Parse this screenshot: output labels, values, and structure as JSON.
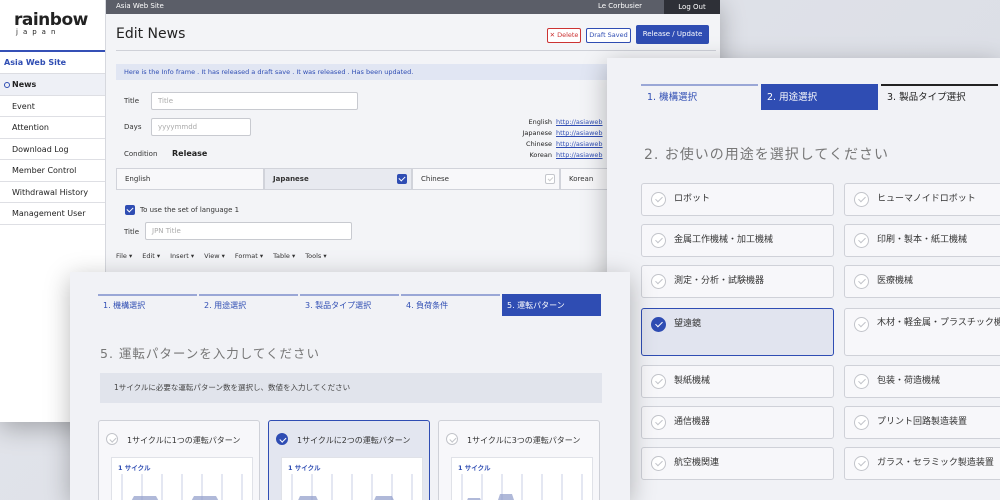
{
  "cms": {
    "logo": {
      "main": "rainbow",
      "sub": "japan"
    },
    "site_name": "Asia Web Site",
    "nav": [
      "News",
      "Event",
      "Attention",
      "Download Log",
      "Member Control",
      "Withdrawal History",
      "Management User"
    ],
    "topbar": {
      "site": "Asia Web Site",
      "user": "Le Corbusier",
      "logout": "Log Out"
    },
    "page_title": "Edit News",
    "buttons": {
      "delete": "✕ Delete",
      "draft": "Draft Saved",
      "release": "Release / Update"
    },
    "info": "Here is the Info frame . It has released a draft save . It was released . Has been updated.",
    "form": {
      "title_label": "Title",
      "title_placeholder": "Title",
      "days_label": "Days",
      "days_placeholder": "yyyymmdd",
      "condition_label": "Condition",
      "condition_value": "Release"
    },
    "languages": [
      {
        "name": "English",
        "url": "http://asiaweb"
      },
      {
        "name": "Japanese",
        "url": "http://asiaweb"
      },
      {
        "name": "Chinese",
        "url": "http://asiaweb"
      },
      {
        "name": "Korean",
        "url": "http://asiaweb"
      }
    ],
    "tabs": [
      "English",
      "Japanese",
      "Chinese",
      "Korean"
    ],
    "use_set_label": "To use the set of language 1",
    "jpn_title_label": "Title",
    "jpn_title_placeholder": "JPN Title",
    "editor_menu": [
      "File ▾",
      "Edit ▾",
      "Insert ▾",
      "View ▾",
      "Format ▾",
      "Table ▾",
      "Tools ▾"
    ]
  },
  "right_panel": {
    "steps": [
      "1. 機構選択",
      "2. 用途選択",
      "3. 製品タイプ選択"
    ],
    "heading": "2. お使いの用途を選択してください",
    "options_left": [
      "ロボット",
      "金属工作機械・加工機械",
      "測定・分析・試験機器",
      "望遠鏡",
      "製紙機械",
      "通信機器",
      "航空機関連"
    ],
    "options_right": [
      "ヒューマノイドロボット",
      "印刷・製本・紙工機械",
      "医療機械",
      "木材・軽金属・プラスチック機械",
      "包装・荷造機械",
      "プリント回路製造装置",
      "ガラス・セラミック製造装置"
    ]
  },
  "bottom_panel": {
    "steps": [
      "1. 機構選択",
      "2. 用途選択",
      "3. 製品タイプ選択",
      "4. 負荷条件",
      "5. 運転パターン"
    ],
    "heading": "5. 運転パターンを入力してください",
    "note": "1サイクルに必要な運転パターン数を選択し、数値を入力してください",
    "cards": [
      {
        "title": "1サイクルに1つの運転パターン",
        "cycle": "1 サイクル"
      },
      {
        "title": "1サイクルに2つの運転パターン",
        "cycle": "1 サイクル"
      },
      {
        "title": "1サイクルに3つの運転パターン",
        "cycle": "1 サイクル"
      }
    ]
  },
  "colors": {
    "accent": "#2f4db3",
    "danger": "#cc3333",
    "topbar": "#5b5e68"
  }
}
